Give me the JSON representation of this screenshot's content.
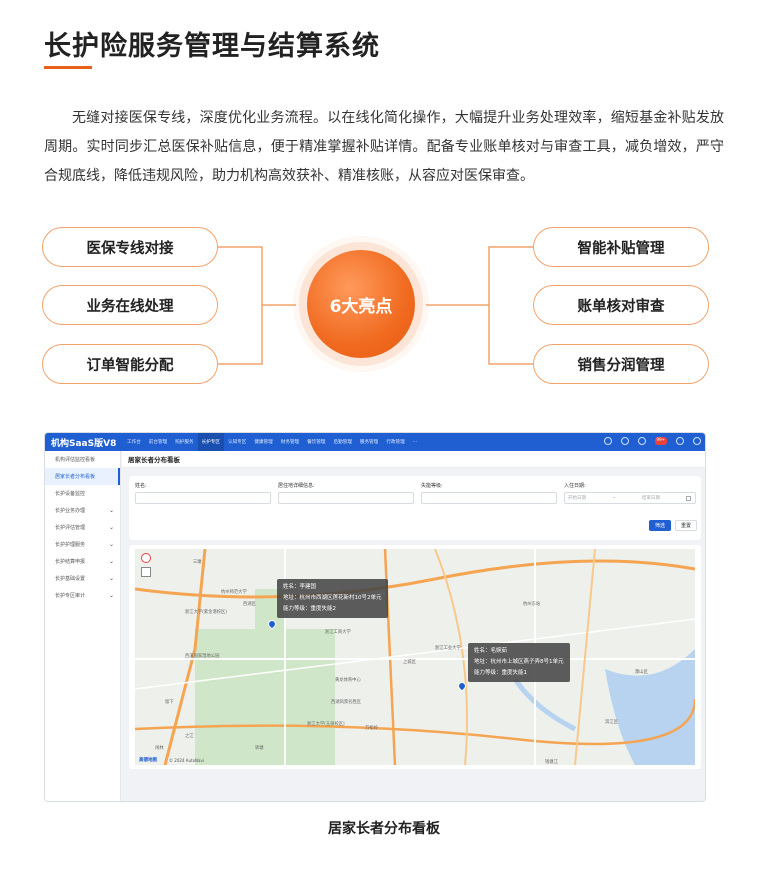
{
  "page": {
    "title": "长护险服务管理与结算系统",
    "intro": "无缝对接医保专线，深度优化业务流程。以在线化简化操作，大幅提升业务处理效率，缩短基金补贴发放周期。实时同步汇总医保补贴信息，便于精准掌握补贴详情。配备专业账单核对与审查工具，减负增效，严守合规底线，降低违规风险，助力机构高效获补、精准核账，从容应对医保审查。",
    "accent_color": "#e8601c",
    "caption": "居家长者分布看板"
  },
  "highlights": {
    "hub_label": "6大亮点",
    "left": [
      "医保专线对接",
      "业务在线处理",
      "订单智能分配"
    ],
    "right": [
      "智能补贴管理",
      "账单核对审查",
      "销售分润管理"
    ]
  },
  "app": {
    "brand": "机构SaaS版V8",
    "nav": [
      "工作台",
      "前台管理",
      "照护服务",
      "长护专区",
      "认知专区",
      "健康管理",
      "财务管理",
      "餐饮管理",
      "后勤管理",
      "服务管理",
      "行政管理",
      "···"
    ],
    "active_nav": "长护专区",
    "notification_count": "99+",
    "sidebar": [
      {
        "label": "机构评估监控看板",
        "chevron": false
      },
      {
        "label": "居家长者分布看板",
        "chevron": false,
        "active": true
      },
      {
        "label": "长护设备监控",
        "chevron": false
      },
      {
        "label": "长护业务办理",
        "chevron": true
      },
      {
        "label": "长护评估管理",
        "chevron": true
      },
      {
        "label": "长护护理服务",
        "chevron": true
      },
      {
        "label": "长护结算申报",
        "chevron": true
      },
      {
        "label": "长护基础设置",
        "chevron": true
      },
      {
        "label": "长护专区审计",
        "chevron": true
      }
    ],
    "page_title": "居家长者分布看板",
    "filters": {
      "name_label": "姓名:",
      "address_label": "居住地详细信息:",
      "level_label": "失能等级:",
      "date_label": "入住日期:",
      "date_start_placeholder": "开始日期",
      "date_sep": "~",
      "date_end_placeholder": "结束日期",
      "search_button": "筛选",
      "reset_button": "重置"
    },
    "map": {
      "labels": [
        "三墩",
        "西湖区",
        "浙江大学(紫金港校区)",
        "灵峰",
        "浙江工商大学",
        "西溪国家湿地公园",
        "留下",
        "闲林",
        "转塘",
        "上城区",
        "浙江大学(玉泉校区)",
        "杭州东站",
        "钱塘江",
        "滨江区",
        "萧山区",
        "浙江工业大学",
        "黄龙体育中心",
        "西湖风景名胜区",
        "万松岭",
        "杭州师范大学",
        "之江"
      ],
      "markers": [
        {
          "name_label": "姓名：",
          "name": "李建国",
          "addr_label": "地址：",
          "addr": "杭州市西湖区莲花新村10号2单元",
          "level_label": "能力等级：",
          "level": "重度失能2"
        },
        {
          "name_label": "姓名：",
          "name": "毛婉茹",
          "addr_label": "地址：",
          "addr": "杭州市上城区燕子弄8号1单元",
          "level_label": "能力等级：",
          "level": "重度失能1"
        }
      ],
      "map_logo": "高德地图",
      "copyright": "© 2024 AutoNavi"
    }
  }
}
